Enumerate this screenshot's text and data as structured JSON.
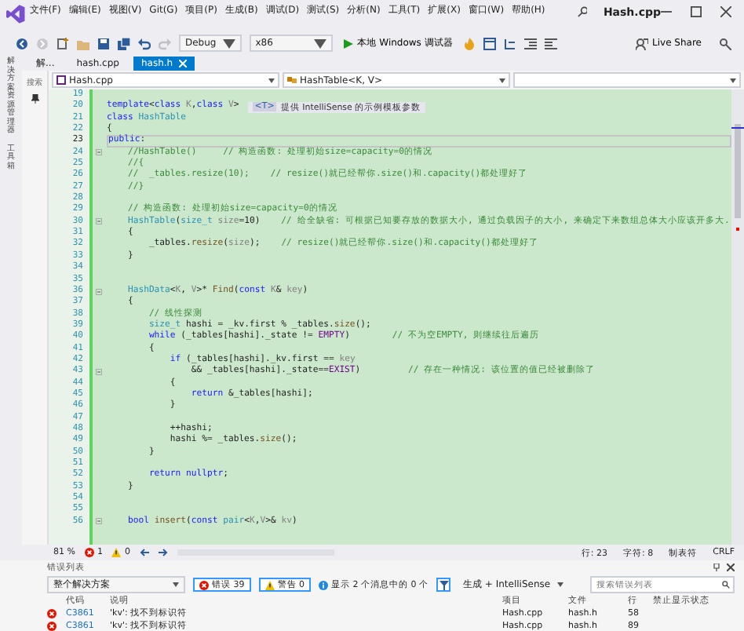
{
  "window": {
    "title": "Hash.cpp"
  },
  "menu": [
    "文件(F)",
    "编辑(E)",
    "视图(V)",
    "Git(G)",
    "项目(P)",
    "生成(B)",
    "调试(D)",
    "测试(S)",
    "分析(N)",
    "工具(T)",
    "扩展(X)",
    "窗口(W)",
    "帮助(H)"
  ],
  "toolbar": {
    "configuration": "Debug",
    "platform": "x86",
    "debugger": "本地 Windows 调试器",
    "live_share": "Live Share"
  },
  "side_tabs": [
    "解决方案资源管理器",
    "工具箱"
  ],
  "side_panel": {
    "search": "搜索"
  },
  "doc_tabs": [
    {
      "label": "解...",
      "selected": false
    },
    {
      "label": "hash.cpp",
      "selected": false
    },
    {
      "label": "hash.h",
      "selected": true
    }
  ],
  "nav": {
    "file": "Hash.cpp",
    "scope": "HashTable<K, V>"
  },
  "editor": {
    "lines": [
      {
        "n": "19",
        "fold": false,
        "current": false
      },
      {
        "n": "20",
        "fold": false,
        "current": false,
        "seg": [
          {
            "kind": "kw",
            "t": "template"
          },
          {
            "kind": "t",
            "t": "<"
          },
          {
            "kind": "kw",
            "t": "class"
          },
          {
            "kind": "param",
            "t": " K"
          },
          {
            "kind": "t",
            "t": ","
          },
          {
            "kind": "kw",
            "t": "class"
          },
          {
            "kind": "param",
            "t": " V"
          },
          {
            "kind": "t",
            "t": ">"
          }
        ],
        "hint": {
          "tag": "<T>",
          "text": "提供 IntelliSense 的示例模板参数"
        }
      },
      {
        "n": "21",
        "fold": false,
        "current": false,
        "seg": [
          {
            "kind": "kw",
            "t": "class"
          },
          {
            "kind": "type",
            "t": " HashTable"
          }
        ]
      },
      {
        "n": "22",
        "fold": false,
        "current": false,
        "seg": [
          {
            "kind": "t",
            "t": "{"
          }
        ]
      },
      {
        "n": "23",
        "fold": false,
        "current": true,
        "seg": [
          {
            "kind": "kw",
            "t": "public"
          },
          {
            "kind": "t",
            "t": ":"
          }
        ]
      },
      {
        "n": "24",
        "fold": true,
        "current": false,
        "seg": [
          {
            "kind": "cm",
            "t": "    //HashTable()     // 构造函数: 处理初始size=capacity=0的情况"
          }
        ]
      },
      {
        "n": "25",
        "fold": false,
        "current": false,
        "seg": [
          {
            "kind": "cm",
            "t": "    //{"
          }
        ]
      },
      {
        "n": "26",
        "fold": false,
        "current": false,
        "seg": [
          {
            "kind": "cm",
            "t": "    //  _tables.resize(10);    // resize()就已经帮你.size()和.capacity()都处理好了"
          }
        ]
      },
      {
        "n": "27",
        "fold": false,
        "current": false,
        "seg": [
          {
            "kind": "cm",
            "t": "    //}"
          }
        ]
      },
      {
        "n": "28",
        "fold": false,
        "current": false
      },
      {
        "n": "29",
        "fold": false,
        "current": false,
        "seg": [
          {
            "kind": "cm",
            "t": "    // 构造函数: 处理初始size=capacity=0的情况"
          }
        ]
      },
      {
        "n": "30",
        "fold": true,
        "current": false,
        "seg": [
          {
            "kind": "type",
            "t": "    HashTable"
          },
          {
            "kind": "t",
            "t": "("
          },
          {
            "kind": "type",
            "t": "size_t"
          },
          {
            "kind": "param",
            "t": " size"
          },
          {
            "kind": "t",
            "t": "=10)    "
          },
          {
            "kind": "cm",
            "t": "// 给全缺省: 可根据已知要存放的数据大小, 通过负载因子的大小, 来确定下来数组总体大小应该开多大."
          }
        ]
      },
      {
        "n": "31",
        "fold": false,
        "current": false,
        "seg": [
          {
            "kind": "t",
            "t": "    {"
          }
        ]
      },
      {
        "n": "32",
        "fold": false,
        "current": false,
        "seg": [
          {
            "kind": "t",
            "t": "        _tables."
          },
          {
            "kind": "fn",
            "t": "resize"
          },
          {
            "kind": "t",
            "t": "("
          },
          {
            "kind": "param",
            "t": "size"
          },
          {
            "kind": "t",
            "t": ");    "
          },
          {
            "kind": "cm",
            "t": "// resize()就已经帮你.size()和.capacity()都处理好了"
          }
        ]
      },
      {
        "n": "33",
        "fold": false,
        "current": false,
        "seg": [
          {
            "kind": "t",
            "t": "    }"
          }
        ]
      },
      {
        "n": "34",
        "fold": false,
        "current": false
      },
      {
        "n": "35",
        "fold": false,
        "current": false
      },
      {
        "n": "36",
        "fold": true,
        "current": false,
        "seg": [
          {
            "kind": "type",
            "t": "    HashData"
          },
          {
            "kind": "t",
            "t": "<"
          },
          {
            "kind": "param",
            "t": "K"
          },
          {
            "kind": "t",
            "t": ", "
          },
          {
            "kind": "param",
            "t": "V"
          },
          {
            "kind": "t",
            "t": ">* "
          },
          {
            "kind": "fn",
            "t": "Find"
          },
          {
            "kind": "t",
            "t": "("
          },
          {
            "kind": "kw",
            "t": "const"
          },
          {
            "kind": "param",
            "t": " K"
          },
          {
            "kind": "t",
            "t": "& "
          },
          {
            "kind": "param",
            "t": "key"
          },
          {
            "kind": "t",
            "t": ")"
          }
        ]
      },
      {
        "n": "37",
        "fold": false,
        "current": false,
        "seg": [
          {
            "kind": "t",
            "t": "    {"
          }
        ]
      },
      {
        "n": "38",
        "fold": false,
        "current": false,
        "seg": [
          {
            "kind": "cm",
            "t": "        // 线性探测"
          }
        ]
      },
      {
        "n": "39",
        "fold": false,
        "current": false,
        "seg": [
          {
            "kind": "type",
            "t": "        size_t"
          },
          {
            "kind": "t",
            "t": " hashi = _kv.first % _tables."
          },
          {
            "kind": "fn",
            "t": "size"
          },
          {
            "kind": "t",
            "t": "();"
          }
        ]
      },
      {
        "n": "40",
        "fold": false,
        "current": false,
        "seg": [
          {
            "kind": "kw",
            "t": "        while"
          },
          {
            "kind": "t",
            "t": " (_tables[hashi]._state != "
          },
          {
            "kind": "macro",
            "t": "EMPTY"
          },
          {
            "kind": "t",
            "t": ")        "
          },
          {
            "kind": "cm",
            "t": "// 不为空EMPTY, 则继续往后遍历"
          }
        ]
      },
      {
        "n": "41",
        "fold": false,
        "current": false,
        "seg": [
          {
            "kind": "t",
            "t": "        {"
          }
        ]
      },
      {
        "n": "42",
        "fold": false,
        "current": false,
        "seg": [
          {
            "kind": "kw",
            "t": "            if"
          },
          {
            "kind": "t",
            "t": " (_tables[hashi]._kv.first == "
          },
          {
            "kind": "param",
            "t": "key"
          }
        ]
      },
      {
        "n": "43",
        "fold": true,
        "current": false,
        "seg": [
          {
            "kind": "t",
            "t": "                && _tables[hashi]._state=="
          },
          {
            "kind": "macro",
            "t": "EXIST"
          },
          {
            "kind": "t",
            "t": ")         "
          },
          {
            "kind": "cm",
            "t": "// 存在一种情况: 该位置的值已经被删除了"
          }
        ]
      },
      {
        "n": "44",
        "fold": false,
        "current": false,
        "seg": [
          {
            "kind": "t",
            "t": "            {"
          }
        ]
      },
      {
        "n": "45",
        "fold": false,
        "current": false,
        "seg": [
          {
            "kind": "kw",
            "t": "                return"
          },
          {
            "kind": "t",
            "t": " &_tables[hashi];"
          }
        ]
      },
      {
        "n": "46",
        "fold": false,
        "current": false,
        "seg": [
          {
            "kind": "t",
            "t": "            }"
          }
        ]
      },
      {
        "n": "47",
        "fold": false,
        "current": false
      },
      {
        "n": "48",
        "fold": false,
        "current": false,
        "seg": [
          {
            "kind": "t",
            "t": "            ++hashi;"
          }
        ]
      },
      {
        "n": "49",
        "fold": false,
        "current": false,
        "seg": [
          {
            "kind": "t",
            "t": "            hashi %= _tables."
          },
          {
            "kind": "fn",
            "t": "size"
          },
          {
            "kind": "t",
            "t": "();"
          }
        ]
      },
      {
        "n": "50",
        "fold": false,
        "current": false,
        "seg": [
          {
            "kind": "t",
            "t": "        }"
          }
        ]
      },
      {
        "n": "51",
        "fold": false,
        "current": false
      },
      {
        "n": "52",
        "fold": false,
        "current": false,
        "seg": [
          {
            "kind": "kw",
            "t": "        return"
          },
          {
            "kind": "kw",
            "t": " nullptr"
          },
          {
            "kind": "t",
            "t": ";"
          }
        ]
      },
      {
        "n": "53",
        "fold": false,
        "current": false,
        "seg": [
          {
            "kind": "t",
            "t": "    }"
          }
        ]
      },
      {
        "n": "54",
        "fold": false,
        "current": false
      },
      {
        "n": "55",
        "fold": false,
        "current": false
      },
      {
        "n": "56",
        "fold": true,
        "current": false,
        "seg": [
          {
            "kind": "kw",
            "t": "    bool"
          },
          {
            "kind": "fn",
            "t": " insert"
          },
          {
            "kind": "t",
            "t": "("
          },
          {
            "kind": "kw",
            "t": "const"
          },
          {
            "kind": "type",
            "t": " pair"
          },
          {
            "kind": "t",
            "t": "<"
          },
          {
            "kind": "param",
            "t": "K"
          },
          {
            "kind": "t",
            "t": ","
          },
          {
            "kind": "param",
            "t": "V"
          },
          {
            "kind": "t",
            "t": ">& "
          },
          {
            "kind": "param",
            "t": "kv"
          },
          {
            "kind": "t",
            "t": ")"
          }
        ]
      }
    ]
  },
  "status": {
    "zoom": "81 %",
    "errors": "1",
    "warnings": "0",
    "line": "行: 23",
    "char": "字符: 8",
    "tabs": "制表符",
    "eol": "CRLF"
  },
  "error_list": {
    "title": "错误列表",
    "scope": "整个解决方案",
    "errors": "错误 39",
    "warnings": "警告 0",
    "messages": "显示 2 个消息中的 0 个",
    "source": "生成 + IntelliSense",
    "search": {
      "placeholder": "搜索错误列表"
    },
    "columns": [
      "代码",
      "说明",
      "项目",
      "文件",
      "行",
      "禁止显示状态"
    ],
    "rows": [
      {
        "code": "C3861",
        "description": "'kv': 找不到标识符",
        "project": "Hash.cpp",
        "file": "hash.h",
        "line": "58"
      },
      {
        "code": "C3861",
        "description": "'kv': 找不到标识符",
        "project": "Hash.cpp",
        "file": "hash.h",
        "line": "89"
      }
    ]
  }
}
